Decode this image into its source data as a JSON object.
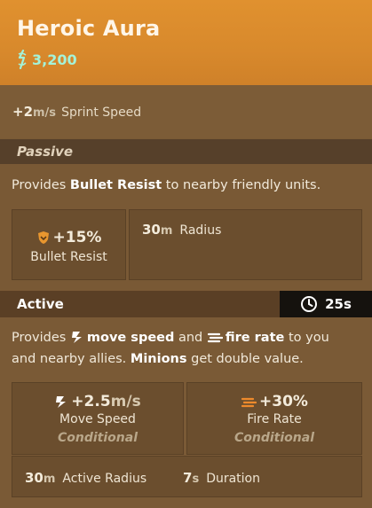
{
  "item": {
    "title": "Heroic Aura",
    "price": "3,200"
  },
  "sprint": {
    "value": "+2",
    "unit": "m/s",
    "label": "Sprint Speed"
  },
  "passive": {
    "header": "Passive",
    "desc_prefix": "Provides ",
    "desc_bold": "Bullet Resist",
    "desc_suffix": " to nearby friendly units.",
    "bullet_resist": {
      "value": "+15%",
      "label": "Bullet Resist"
    },
    "radius": {
      "value": "30",
      "unit": "m",
      "label": "Radius"
    }
  },
  "active": {
    "header": "Active",
    "cooldown": "25s",
    "desc": {
      "p1": "Provides ",
      "b1": "move speed",
      "p2": " and ",
      "b2": "fire rate",
      "p3": " to you",
      "p4": "and nearby allies. ",
      "b3": "Minions",
      "p5": " get double value."
    },
    "move_speed": {
      "value": "+2.5",
      "unit": "m/s",
      "label": "Move Speed",
      "cond": "Conditional"
    },
    "fire_rate": {
      "value": "+30%",
      "label": "Fire Rate",
      "cond": "Conditional"
    },
    "active_radius": {
      "value": "30",
      "unit": "m",
      "label": "Active Radius"
    },
    "duration": {
      "value": "7",
      "unit": "s",
      "label": "Duration"
    }
  },
  "colors": {
    "header": "#e0912f",
    "price": "#a4f2d8",
    "card": "#7a5a35",
    "section_bar": "#56402a",
    "cooldown_bg": "#15120e"
  }
}
